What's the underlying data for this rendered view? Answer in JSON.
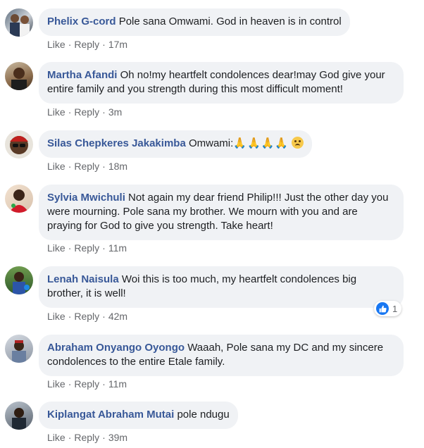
{
  "comments": [
    {
      "name": "Phelix G-cord",
      "text": "Pole sana Omwami. God in heaven is in control",
      "like": "Like",
      "reply": "Reply",
      "time": "17m"
    },
    {
      "name": "Martha Afandi",
      "text": "Oh no!my heartfelt condolences dear!may God give your entire family and you strength during this most difficult moment!",
      "like": "Like",
      "reply": "Reply",
      "time": "3m"
    },
    {
      "name": "Silas Chepkeres Jakakimba",
      "text": "Omwami:",
      "emoji": "🙏🙏🙏🙏",
      "like": "Like",
      "reply": "Reply",
      "time": "18m"
    },
    {
      "name": "Sylvia Mwichuli",
      "text": "Not again my dear friend Philip!!! Just the other day you were mourning. Pole sana my brother. We mourn with you and are praying for God to give you strength. Take heart!",
      "like": "Like",
      "reply": "Reply",
      "time": "11m"
    },
    {
      "name": "Lenah Naisula",
      "text": "Woi this is too much, my heartfelt condolences big brother, it is well!",
      "like": "Like",
      "reply": "Reply",
      "time": "42m",
      "reaction_count": "1"
    },
    {
      "name": "Abraham Onyango Oyongo",
      "text": "Waaah, Pole sana my DC and my sincere condolences to the entire Etale family.",
      "like": "Like",
      "reply": "Reply",
      "time": "11m"
    },
    {
      "name": "Kiplangat Abraham Mutai",
      "text": "pole ndugu",
      "like": "Like",
      "reply": "Reply",
      "time": "39m"
    }
  ],
  "colors": {
    "name": "#385898",
    "bubble": "#f0f2f5",
    "meta": "#65676b",
    "like_blue": "#1877f2"
  }
}
